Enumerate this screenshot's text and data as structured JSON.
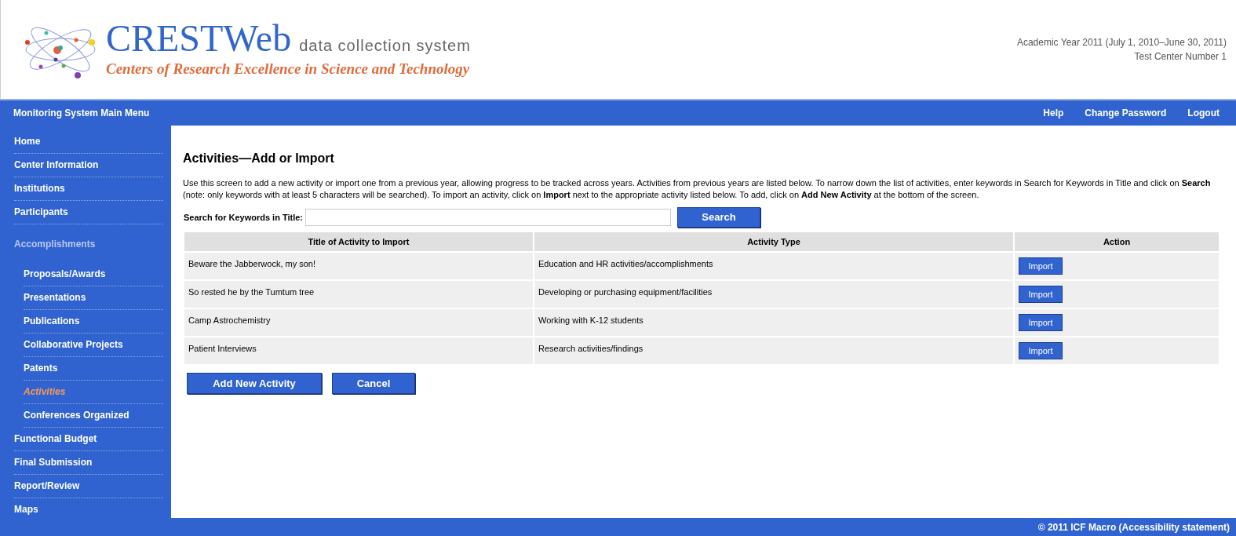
{
  "header": {
    "logo_title": "CRESTWeb",
    "logo_subtitle": "data collection system",
    "logo_tagline": "Centers of Research Excellence in Science and Technology",
    "academic_year": "Academic Year 2011 (July 1, 2010–June 30, 2011)",
    "center": "Test Center Number 1"
  },
  "navbar": {
    "title": "Monitoring System Main Menu",
    "links": [
      "Help",
      "Change Password",
      "Logout"
    ]
  },
  "sidebar": {
    "items": [
      {
        "label": "Home",
        "kind": "link",
        "selected": false
      },
      {
        "label": "Center Information",
        "kind": "link",
        "selected": false
      },
      {
        "label": "Institutions",
        "kind": "link",
        "selected": false
      },
      {
        "label": "Participants",
        "kind": "link",
        "selected": false
      },
      {
        "label": "Accomplishments",
        "kind": "heading",
        "children": [
          {
            "label": "Proposals/Awards",
            "kind": "link",
            "selected": false
          },
          {
            "label": "Presentations",
            "kind": "link",
            "selected": false
          },
          {
            "label": "Publications",
            "kind": "link",
            "selected": false
          },
          {
            "label": "Collaborative Projects",
            "kind": "link",
            "selected": false
          },
          {
            "label": "Patents",
            "kind": "link",
            "selected": false
          },
          {
            "label": "Activities",
            "kind": "link",
            "selected": true
          },
          {
            "label": "Conferences Organized",
            "kind": "link",
            "selected": false
          }
        ]
      },
      {
        "label": "Functional Budget",
        "kind": "link",
        "selected": false
      },
      {
        "label": "Final Submission",
        "kind": "link",
        "selected": false
      },
      {
        "label": "Report/Review",
        "kind": "link",
        "selected": false
      },
      {
        "label": "Maps",
        "kind": "link",
        "selected": false
      }
    ]
  },
  "main": {
    "title": "Activities—Add or Import",
    "instructions": "Use this screen to add a new activity or import one from a previous year, allowing progress to be tracked across years. Activities from previous years are listed below. To narrow down the list of activities, enter keywords in Search for Keywords in Title and click on **Search** (note: only keywords with at least 5 characters will be searched). To import an activity, click on **Import** next to the appropriate activity listed below. To add, click on **Add New Activity** at the bottom of the screen.",
    "search": {
      "label": "Search for Keywords in Title:",
      "button": "Search"
    },
    "table": {
      "columns": [
        "Title of Activity to Import",
        "Activity Type",
        "Action"
      ],
      "rows": [
        {
          "title": "Beware the Jabberwock, my son!",
          "type": "Education and HR activities/accomplishments",
          "action": "Import"
        },
        {
          "title": "So rested he by the Tumtum tree",
          "type": "Developing or purchasing equipment/facilities",
          "action": "Import"
        },
        {
          "title": "Camp Astrochemistry",
          "type": "Working with K-12 students",
          "action": "Import"
        },
        {
          "title": "Patient Interviews",
          "type": "Research activities/findings",
          "action": "Import"
        }
      ]
    },
    "buttons": [
      "Add New Activity",
      "Cancel"
    ]
  },
  "footer": "© 2011 ICF Macro (Accessibility statement)"
}
